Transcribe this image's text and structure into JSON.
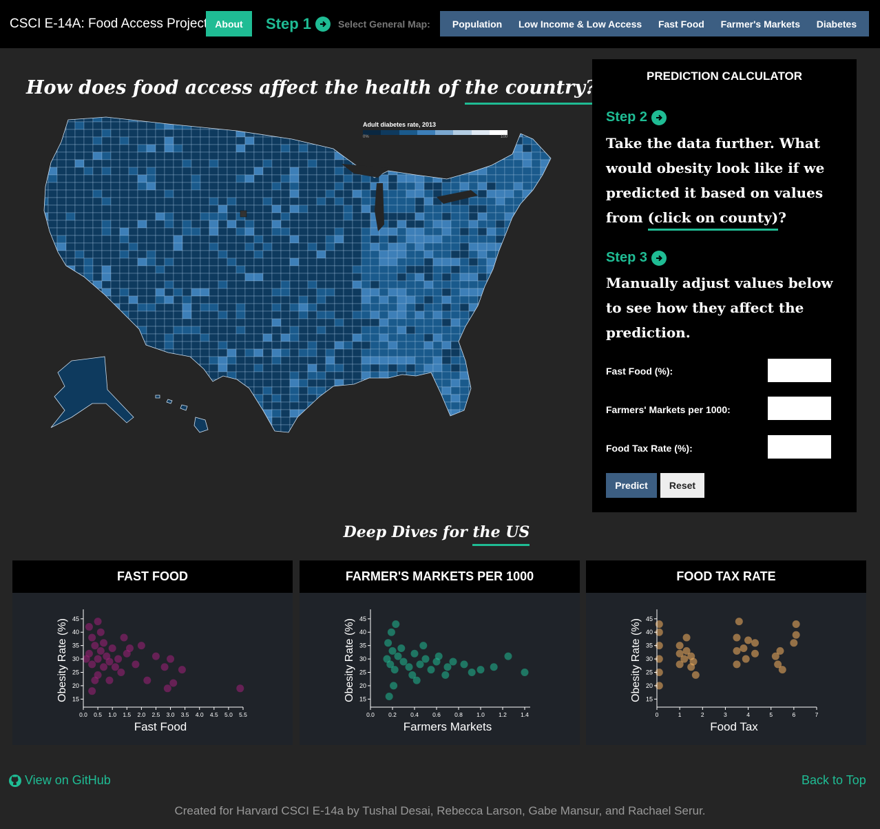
{
  "nav": {
    "brand": "CSCI E-14A: Food Access Project",
    "about_label": "About",
    "step1_label": "Step 1",
    "select_label": "Select General Map:",
    "map_options": [
      "Population",
      "Low Income & Low Access",
      "Fast Food",
      "Farmer's Markets",
      "Diabetes"
    ]
  },
  "map": {
    "headline_prefix": "How does food access affect the health of ",
    "headline_accent": "the country?",
    "legend_title": "Adult diabetes rate, 2013",
    "legend_min": "0%",
    "legend_max": "100",
    "colors": {
      "dark": "#0e3a5e",
      "mid": "#1a5a8c",
      "light": "#3d7fb8"
    }
  },
  "calculator": {
    "title": "PREDICTION CALCULATOR",
    "step2_label": "Step 2",
    "step2_text_a": "Take the data further. What would obesity look like if we predicted it based on values from ",
    "step2_link": "(click on county)",
    "step2_text_b": "?",
    "step3_label": "Step 3",
    "step3_text": "Manually adjust values below to see how they affect the prediction.",
    "fields": [
      "Fast Food (%):",
      "Farmers' Markets per 1000:",
      "Food Tax Rate (%):"
    ],
    "predict_label": "Predict",
    "reset_label": "Reset"
  },
  "deep_dives": {
    "title_prefix": "Deep Dives for ",
    "title_accent": "the US"
  },
  "chart_data": [
    {
      "type": "scatter",
      "title": "FAST FOOD",
      "xlabel": "Fast Food",
      "ylabel": "Obesity Rate (%)",
      "xlim": [
        0,
        5.5
      ],
      "ylim": [
        12,
        47
      ],
      "xticks": [
        0.0,
        0.5,
        1.0,
        1.5,
        2.0,
        2.5,
        3.0,
        3.5,
        4.0,
        4.5,
        5.0,
        5.5
      ],
      "yticks": [
        15,
        20,
        25,
        30,
        35,
        40,
        45
      ],
      "color": "#a0207a",
      "points": [
        [
          0.2,
          32
        ],
        [
          0.3,
          28
        ],
        [
          0.4,
          35
        ],
        [
          0.5,
          30
        ],
        [
          0.6,
          33
        ],
        [
          0.7,
          27
        ],
        [
          0.3,
          38
        ],
        [
          0.5,
          24
        ],
        [
          0.8,
          31
        ],
        [
          0.9,
          29
        ],
        [
          0.4,
          22
        ],
        [
          0.6,
          40
        ],
        [
          1.0,
          34
        ],
        [
          1.1,
          27
        ],
        [
          1.2,
          30
        ],
        [
          0.2,
          42
        ],
        [
          0.3,
          18
        ],
        [
          0.7,
          36
        ],
        [
          0.5,
          44
        ],
        [
          1.3,
          25
        ],
        [
          1.5,
          32
        ],
        [
          1.8,
          28
        ],
        [
          2.0,
          35
        ],
        [
          2.2,
          22
        ],
        [
          2.5,
          31
        ],
        [
          2.8,
          27
        ],
        [
          3.0,
          30
        ],
        [
          2.9,
          19
        ],
        [
          3.4,
          26
        ],
        [
          3.1,
          21
        ],
        [
          5.4,
          19
        ],
        [
          1.4,
          38
        ],
        [
          0.1,
          30
        ],
        [
          0.9,
          22
        ],
        [
          1.6,
          34
        ]
      ]
    },
    {
      "type": "scatter",
      "title": "FARMER'S MARKETS PER 1000",
      "xlabel": "Farmers Markets",
      "ylabel": "Obesity Rate (%)",
      "xlim": [
        0,
        1.45
      ],
      "ylim": [
        12,
        47
      ],
      "xticks": [
        0.0,
        0.2,
        0.4,
        0.6,
        0.8,
        1.0,
        1.2,
        1.4
      ],
      "yticks": [
        15,
        20,
        25,
        30,
        35,
        40,
        45
      ],
      "color": "#1fbc94",
      "points": [
        [
          0.15,
          30
        ],
        [
          0.18,
          28
        ],
        [
          0.2,
          33
        ],
        [
          0.22,
          26
        ],
        [
          0.16,
          36
        ],
        [
          0.25,
          31
        ],
        [
          0.3,
          29
        ],
        [
          0.19,
          40
        ],
        [
          0.21,
          20
        ],
        [
          0.28,
          34
        ],
        [
          0.35,
          27
        ],
        [
          0.4,
          32
        ],
        [
          0.45,
          28
        ],
        [
          0.38,
          24
        ],
        [
          0.5,
          30
        ],
        [
          0.55,
          26
        ],
        [
          0.6,
          29
        ],
        [
          0.48,
          35
        ],
        [
          0.62,
          31
        ],
        [
          0.7,
          27
        ],
        [
          0.75,
          29
        ],
        [
          0.85,
          28
        ],
        [
          0.92,
          25
        ],
        [
          1.0,
          26
        ],
        [
          1.12,
          27
        ],
        [
          1.25,
          31
        ],
        [
          1.4,
          25
        ],
        [
          0.17,
          16
        ],
        [
          0.23,
          43
        ],
        [
          0.42,
          22
        ],
        [
          0.68,
          24
        ]
      ]
    },
    {
      "type": "scatter",
      "title": "FOOD TAX RATE",
      "xlabel": "Food Tax",
      "ylabel": "Obesity Rate (%)",
      "xlim": [
        0,
        7
      ],
      "ylim": [
        12,
        47
      ],
      "xticks": [
        0,
        1,
        2,
        3,
        4,
        5,
        6,
        7
      ],
      "yticks": [
        15,
        20,
        25,
        30,
        35,
        40,
        45
      ],
      "color": "#f5b261",
      "points": [
        [
          0.1,
          30
        ],
        [
          0.1,
          25
        ],
        [
          0.1,
          35
        ],
        [
          0.1,
          40
        ],
        [
          0.1,
          20
        ],
        [
          0.1,
          43
        ],
        [
          1.0,
          32
        ],
        [
          1.0,
          28
        ],
        [
          1.0,
          35
        ],
        [
          1.2,
          30
        ],
        [
          1.3,
          33
        ],
        [
          1.3,
          38
        ],
        [
          1.5,
          27
        ],
        [
          1.5,
          31
        ],
        [
          1.6,
          29
        ],
        [
          1.7,
          24
        ],
        [
          3.5,
          38
        ],
        [
          3.5,
          33
        ],
        [
          3.5,
          28
        ],
        [
          3.6,
          44
        ],
        [
          3.8,
          34
        ],
        [
          3.9,
          30
        ],
        [
          4.0,
          37
        ],
        [
          4.3,
          32
        ],
        [
          4.3,
          36
        ],
        [
          5.2,
          31
        ],
        [
          5.3,
          28
        ],
        [
          5.4,
          33
        ],
        [
          5.5,
          26
        ],
        [
          6.1,
          39
        ],
        [
          6.1,
          43
        ],
        [
          6.0,
          36
        ]
      ]
    }
  ],
  "footer": {
    "github_label": "View on GitHub",
    "top_label": "Back to Top",
    "credits": "Created for Harvard CSCI E-14a by Tushal Desai, Rebecca Larson, Gabe Mansur, and Rachael Serur."
  }
}
